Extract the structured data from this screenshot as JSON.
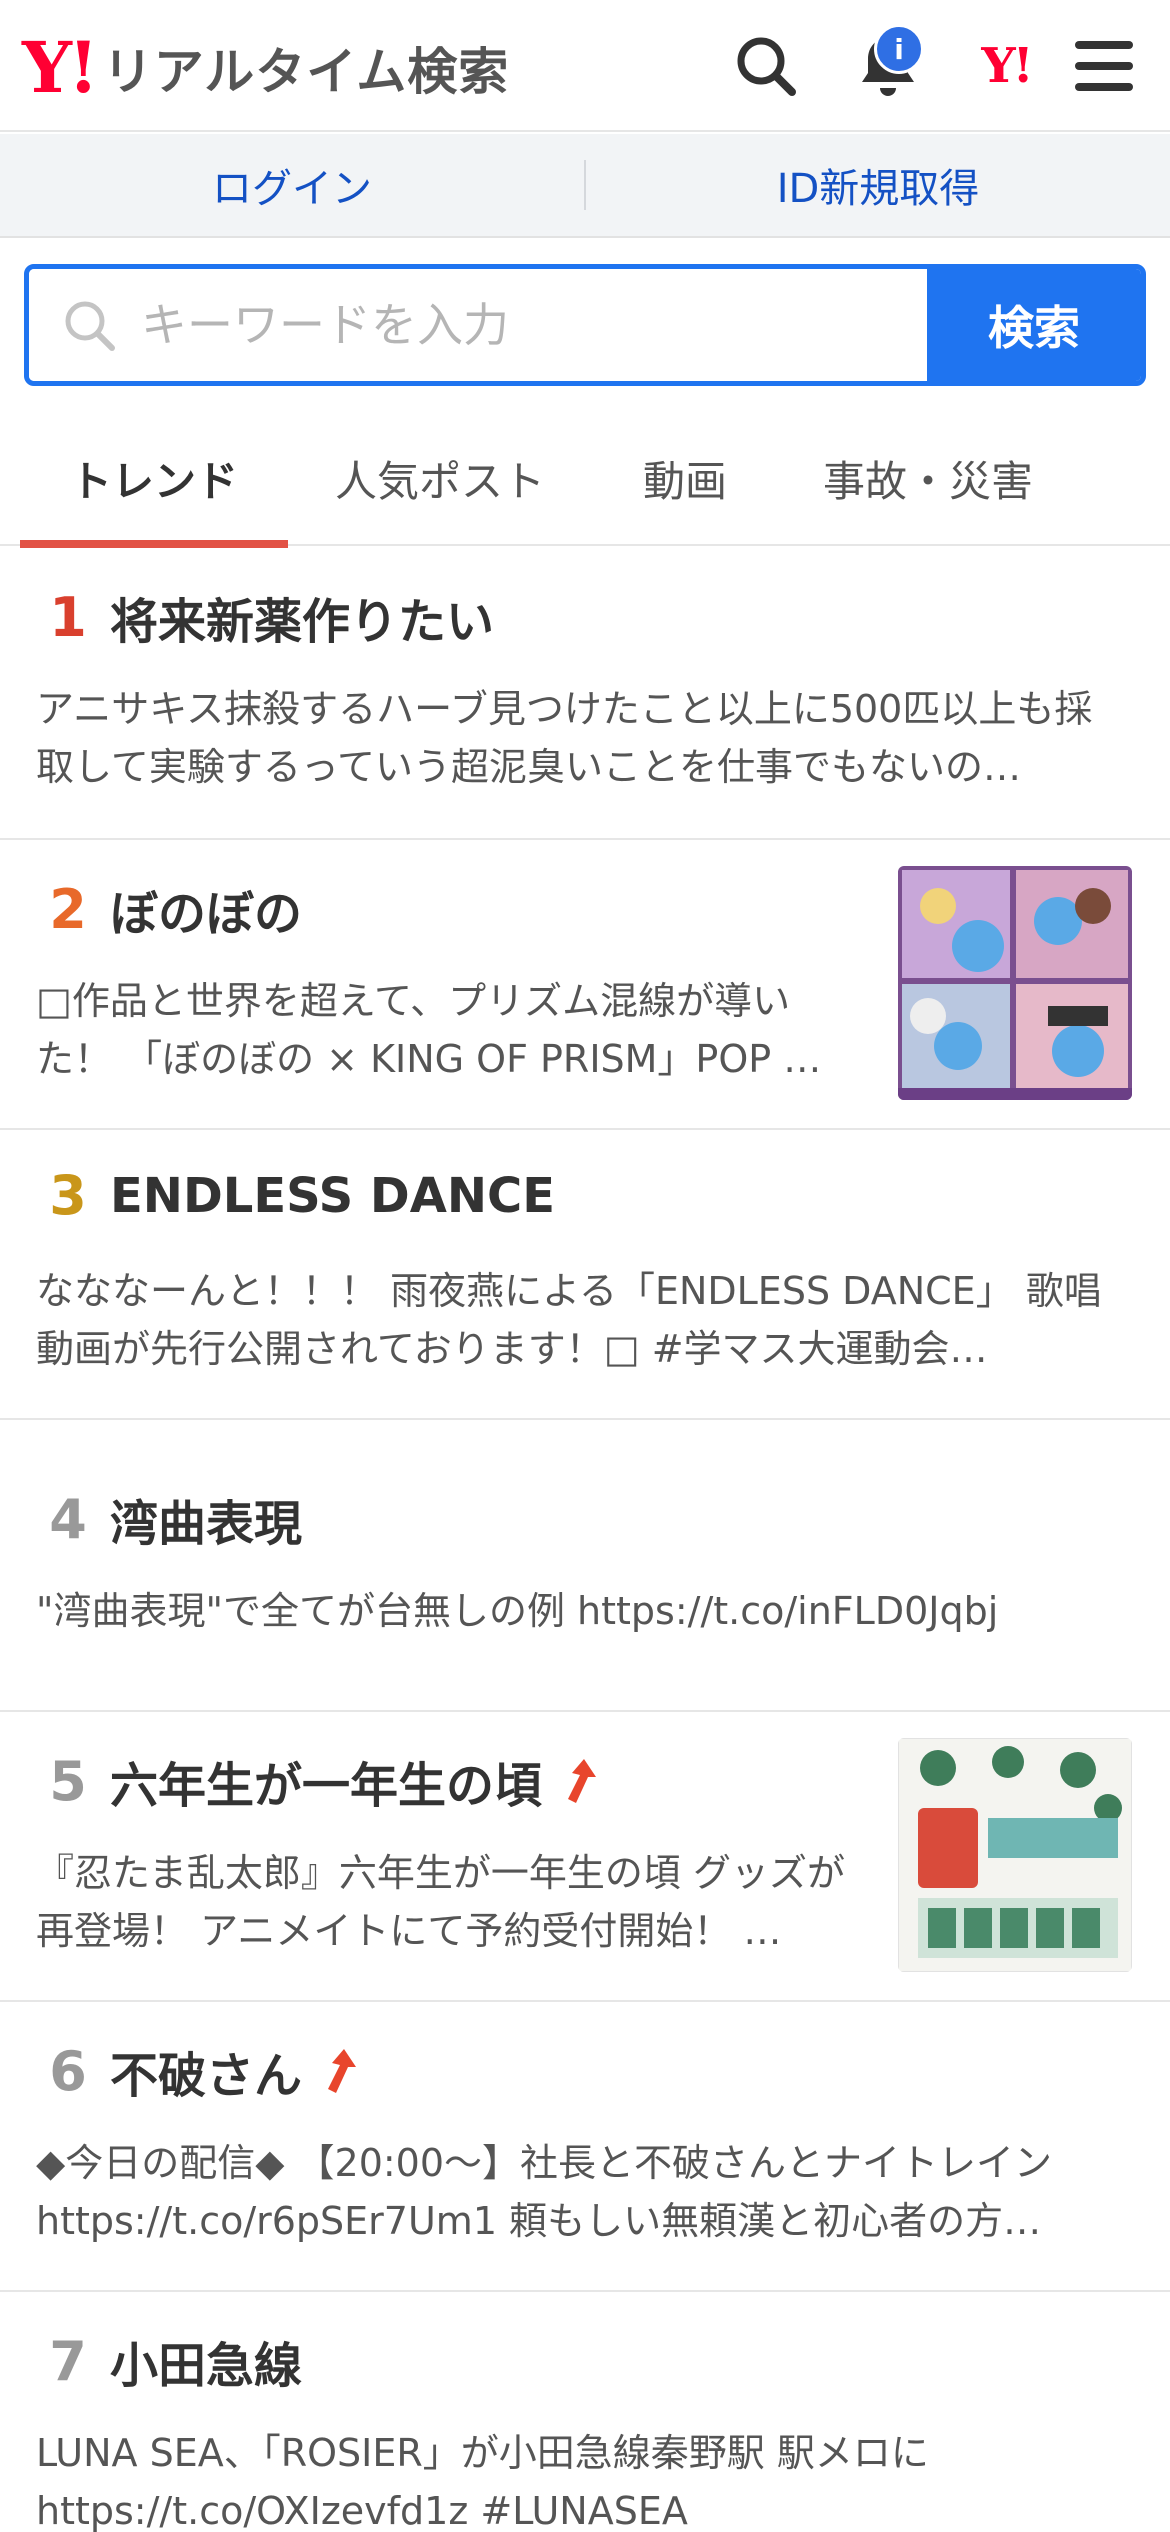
{
  "header": {
    "logo_mark": "Y!",
    "logo_text": "リアルタイム検索",
    "notification_count": "i",
    "yahoo_mark": "Y!"
  },
  "account": {
    "login": "ログイン",
    "register": "ID新規取得"
  },
  "search": {
    "placeholder": "キーワードを入力",
    "button": "検索"
  },
  "tabs": [
    "トレンド",
    "人気ポスト",
    "動画",
    "事故・災害"
  ],
  "trends": [
    {
      "rank": "1",
      "title": "将来新薬作りたい",
      "desc": "アニサキス抹殺するハーブ見つけたこと以上に500匹以上も採取して実験するっていう超泥臭いことを仕事でもないの…"
    },
    {
      "rank": "2",
      "title": "ぼのぼの",
      "desc": "□作品と世界を超えて、プリズム混線が導いた！ 「ぼのぼの × KING OF PRISM」POP …"
    },
    {
      "rank": "3",
      "title": "ENDLESS DANCE",
      "desc": "なななーんと！！！ 雨夜燕による「ENDLESS DANCE」 歌唱動画が先行公開されております！□ #学マス大運動会…"
    },
    {
      "rank": "4",
      "title": "湾曲表現",
      "desc": "\"湾曲表現\"で全てが台無しの例 https://t.co/inFLD0Jqbj"
    },
    {
      "rank": "5",
      "title": "六年生が一年生の頃",
      "desc": "『忍たま乱太郎』六年生が一年生の頃 グッズが再登場！ アニメイトにて予約受付開始！ …"
    },
    {
      "rank": "6",
      "title": "不破さん",
      "desc": "◆今日の配信◆ 【20:00〜】社長と不破さんとナイトレイン https://t.co/r6pSEr7Um1 頼もしい無頼漢と初心者の方…"
    },
    {
      "rank": "7",
      "title": "小田急線",
      "desc": "LUNA SEA、「ROSIER」が小田急線秦野駅 駅メロに https://t.co/OXIzevfd1z #LUNASEA"
    }
  ],
  "colors": {
    "accent_blue": "#1f74f0",
    "rank1": "#d9402e",
    "rank2": "#e8692a",
    "rank3": "#c9961a",
    "rank_other": "#999999",
    "tab_underline": "#e25245"
  }
}
